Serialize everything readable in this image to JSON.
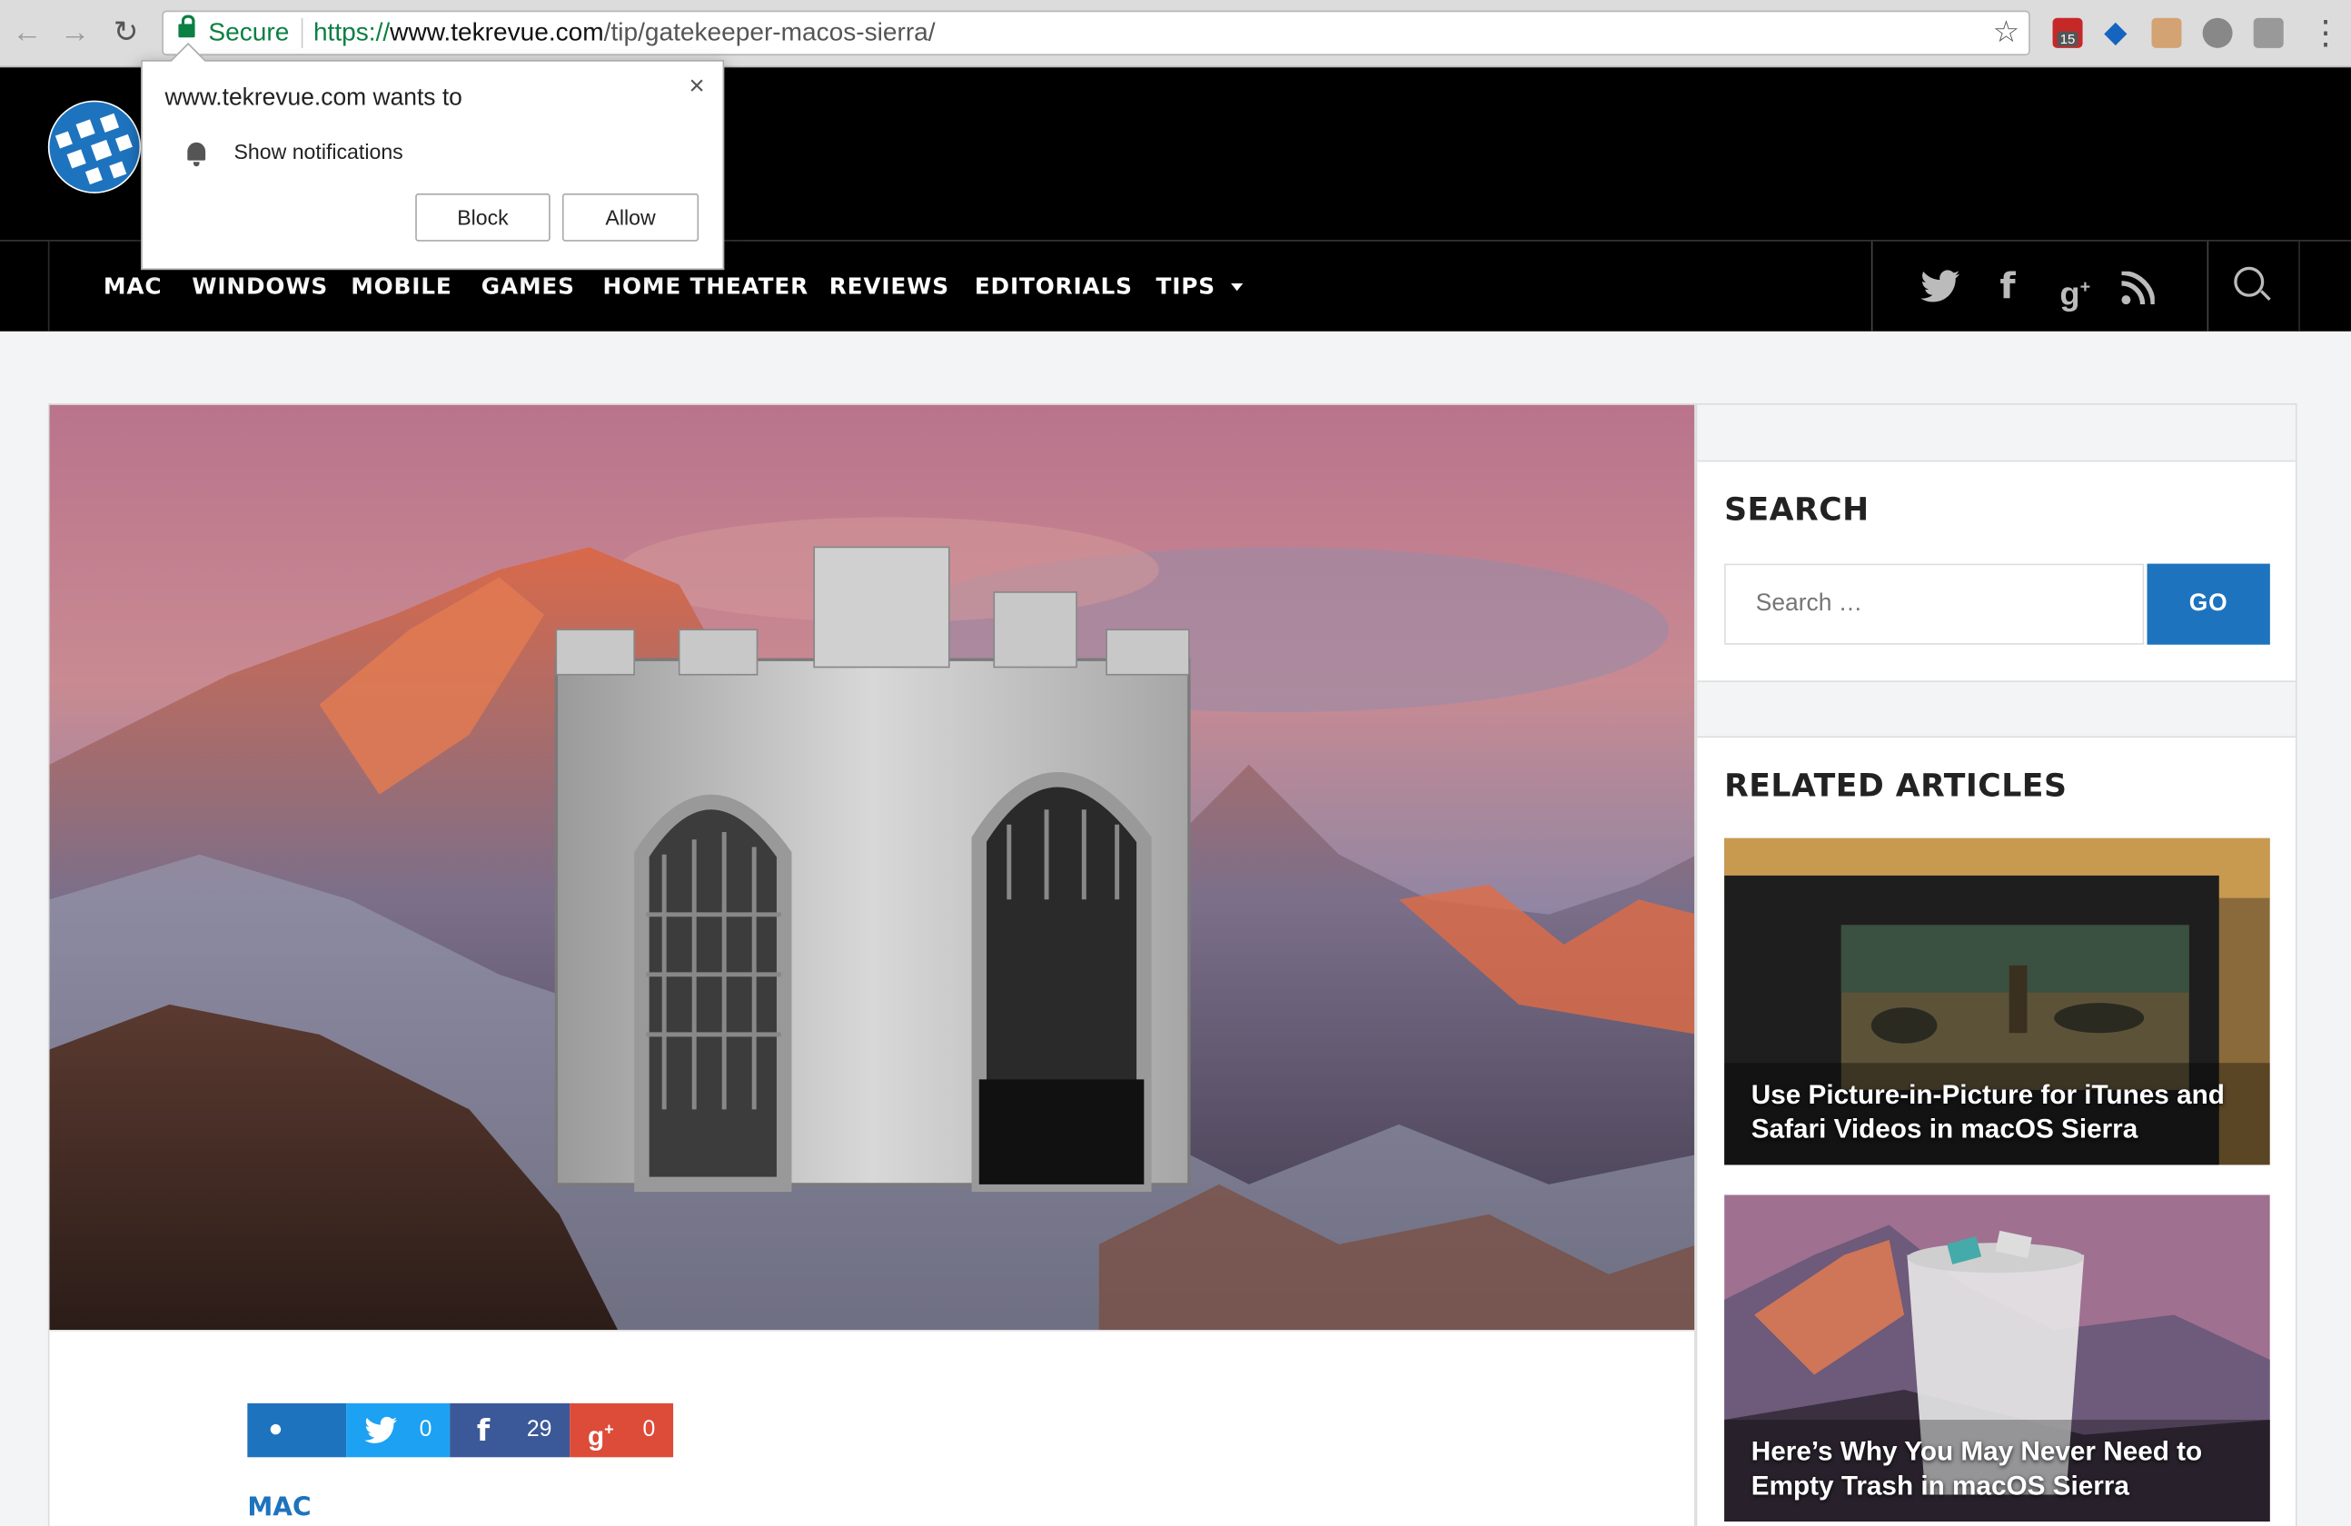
{
  "browser": {
    "secure_label": "Secure",
    "url_scheme": "https://",
    "url_host": "www.tekrevue.com",
    "url_path": "/tip/gatekeeper-macos-sierra/",
    "ext_badge": "15"
  },
  "popup": {
    "title": "www.tekrevue.com wants to",
    "permission": "Show notifications",
    "block_label": "Block",
    "allow_label": "Allow",
    "close_glyph": "×"
  },
  "nav": {
    "items": [
      "MAC",
      "WINDOWS",
      "MOBILE",
      "GAMES",
      "HOME THEATER",
      "REVIEWS",
      "EDITORIALS",
      "TIPS"
    ]
  },
  "share": {
    "twitter_count": "0",
    "facebook_count": "29",
    "gplus_count": "0"
  },
  "article": {
    "category": "MAC"
  },
  "sidebar": {
    "search_title": "SEARCH",
    "search_placeholder": "Search …",
    "go_label": "GO",
    "related_title": "RELATED ARTICLES",
    "related": [
      {
        "title": "Use Picture-in-Picture for iTunes and Safari Videos in macOS Sierra"
      },
      {
        "title": "Here’s Why You May Never Need to Empty Trash in macOS Sierra"
      }
    ]
  },
  "colors": {
    "brand_blue": "#1e73be",
    "twitter": "#1da1f2",
    "facebook": "#3b5998",
    "gplus": "#dd4b39",
    "comments": "#1e73be"
  }
}
